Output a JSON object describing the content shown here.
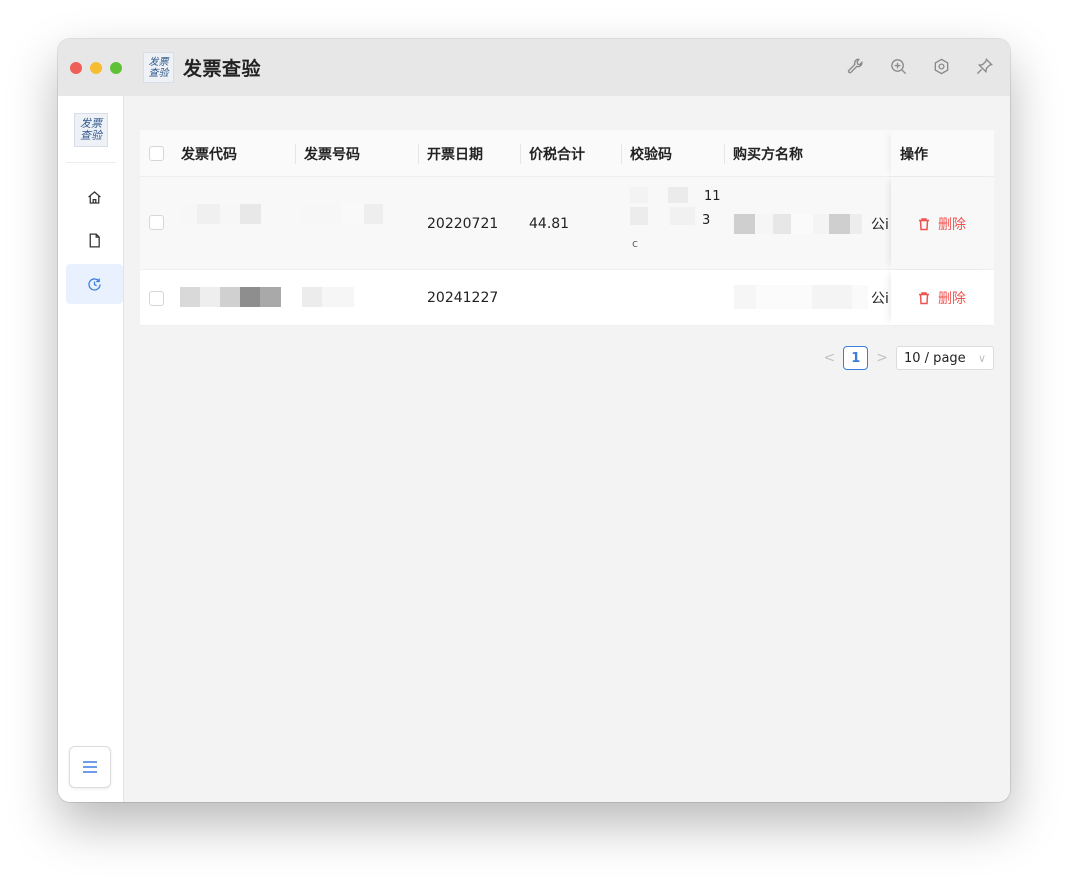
{
  "app": {
    "title": "发票查验",
    "logo_text_line1": "发票",
    "logo_text_line2": "查验"
  },
  "titlebar_tools": [
    "wrench-icon",
    "zoom-in-icon",
    "settings-icon",
    "pin-icon"
  ],
  "sidebar": {
    "logo_line1": "发票",
    "logo_line2": "查验",
    "items": [
      {
        "name": "home-icon",
        "active": false
      },
      {
        "name": "document-icon",
        "active": false
      },
      {
        "name": "history-icon",
        "active": true
      }
    ]
  },
  "table": {
    "headers": {
      "invoice_code": "发票代码",
      "invoice_number": "发票号码",
      "issue_date": "开票日期",
      "total_amount": "价税合计",
      "check_code": "校验码",
      "buyer_name": "购买方名称",
      "actions": "操作"
    },
    "rows": [
      {
        "issue_date": "20220721",
        "total_amount": "44.81",
        "check_code_line1": "11",
        "check_code_line2": "3",
        "check_code_line3": "c",
        "buyer_suffix": "公i",
        "delete_label": "删除"
      },
      {
        "issue_date": "20241227",
        "total_amount": "",
        "buyer_suffix": "公i",
        "delete_label": "删除"
      }
    ]
  },
  "pagination": {
    "prev": "<",
    "current_page": "1",
    "next": ">",
    "page_size": "10 / page"
  },
  "colors": {
    "accent": "#3b7ddd",
    "danger": "#ef5350"
  }
}
